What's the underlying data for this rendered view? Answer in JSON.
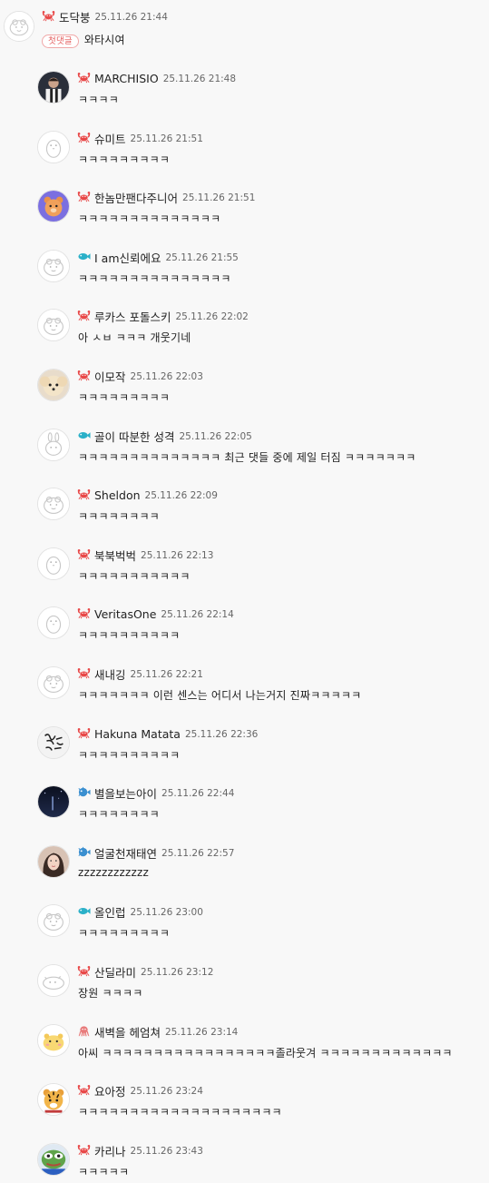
{
  "parent": {
    "nick": "도닥붕",
    "time": "25.11.26 21:44",
    "tag": "첫댓글",
    "text": "와타시여",
    "level": "crab"
  },
  "replies": [
    {
      "nick": "MARCHISIO",
      "time": "25.11.26 21:48",
      "text": "ㅋㅋㅋㅋ",
      "level": "crab",
      "avatar": "photo-soccer"
    },
    {
      "nick": "슈미트",
      "time": "25.11.26 21:51",
      "text": "ㅋㅋㅋㅋㅋㅋㅋㅋㅋ",
      "level": "crab",
      "avatar": "default-penguin"
    },
    {
      "nick": "한놈만팬다주니어",
      "time": "25.11.26 21:51",
      "text": "ㅋㅋㅋㅋㅋㅋㅋㅋㅋㅋㅋㅋㅋㅋ",
      "level": "crab",
      "avatar": "bear-purple"
    },
    {
      "nick": "I am신뢰에요",
      "time": "25.11.26 21:55",
      "text": "ㅋㅋㅋㅋㅋㅋㅋㅋㅋㅋㅋㅋㅋㅋㅋ",
      "level": "fish",
      "avatar": "default-face"
    },
    {
      "nick": "루카스 포돌스키",
      "time": "25.11.26 22:02",
      "text": "아 ㅅㅂ ㅋㅋㅋ 개웃기네",
      "level": "crab",
      "avatar": "default-face"
    },
    {
      "nick": "이모작",
      "time": "25.11.26 22:03",
      "text": "ㅋㅋㅋㅋㅋㅋㅋㅋㅋ",
      "level": "crab",
      "avatar": "photo-dog"
    },
    {
      "nick": "골이 따분한 성격",
      "time": "25.11.26 22:05",
      "text": "ㅋㅋㅋㅋㅋㅋㅋㅋㅋㅋㅋㅋㅋㅋ 최근 댓들 중에 제일 터짐 ㅋㅋㅋㅋㅋㅋㅋ",
      "level": "fish",
      "avatar": "default-rabbit"
    },
    {
      "nick": "Sheldon",
      "time": "25.11.26 22:09",
      "text": "ㅋㅋㅋㅋㅋㅋㅋㅋ",
      "level": "crab",
      "avatar": "default-face"
    },
    {
      "nick": "북북벅벅",
      "time": "25.11.26 22:13",
      "text": "ㅋㅋㅋㅋㅋㅋㅋㅋㅋㅋㅋ",
      "level": "crab",
      "avatar": "default-penguin"
    },
    {
      "nick": "VeritasOne",
      "time": "25.11.26 22:14",
      "text": "ㅋㅋㅋㅋㅋㅋㅋㅋㅋㅋ",
      "level": "crab",
      "avatar": "default-penguin"
    },
    {
      "nick": "새내깅",
      "time": "25.11.26 22:21",
      "text": "ㅋㅋㅋㅋㅋㅋㅋ 이런 센스는 어디서 나는거지 진짜ㅋㅋㅋㅋㅋ",
      "level": "crab",
      "avatar": "default-face"
    },
    {
      "nick": "Hakuna Matata",
      "time": "25.11.26 22:36",
      "text": "ㅋㅋㅋㅋㅋㅋㅋㅋㅋㅋ",
      "level": "crab",
      "avatar": "photo-calligraphy"
    },
    {
      "nick": "별을보는아이",
      "time": "25.11.26 22:44",
      "text": "ㅋㅋㅋㅋㅋㅋㅋㅋ",
      "level": "blowfish",
      "avatar": "photo-night"
    },
    {
      "nick": "얼굴천재태연",
      "time": "25.11.26 22:57",
      "text": "zzzzzzzzzzzz",
      "level": "blowfish",
      "avatar": "photo-person"
    },
    {
      "nick": "올인럽",
      "time": "25.11.26 23:00",
      "text": "ㅋㅋㅋㅋㅋㅋㅋㅋㅋ",
      "level": "fish",
      "avatar": "default-face"
    },
    {
      "nick": "산딜라미",
      "time": "25.11.26 23:12",
      "text": "장원 ㅋㅋㅋㅋ",
      "level": "crab",
      "avatar": "default-seal"
    },
    {
      "nick": "새벽을 헤엄쳐",
      "time": "25.11.26 23:14",
      "text": "아씨 ㅋㅋㅋㅋㅋㅋㅋㅋㅋㅋㅋㅋㅋㅋㅋㅋㅋ졸라웃겨 ㅋㅋㅋㅋㅋㅋㅋㅋㅋㅋㅋㅋㅋ",
      "level": "octopus",
      "avatar": "hamster"
    },
    {
      "nick": "요아정",
      "time": "25.11.26 23:24",
      "text": "ㅋㅋㅋㅋㅋㅋㅋㅋㅋㅋㅋㅋㅋㅋㅋㅋㅋㅋㅋㅋ",
      "level": "crab",
      "avatar": "tiger"
    },
    {
      "nick": "카리나",
      "time": "25.11.26 23:43",
      "text": "ㅋㅋㅋㅋㅋ",
      "level": "crab",
      "avatar": "photo-pepe"
    }
  ],
  "colors": {
    "crab": "#e84848",
    "fish": "#2ab0c8",
    "blowfish": "#3a8fd0",
    "octopus": "#e87a7a"
  }
}
